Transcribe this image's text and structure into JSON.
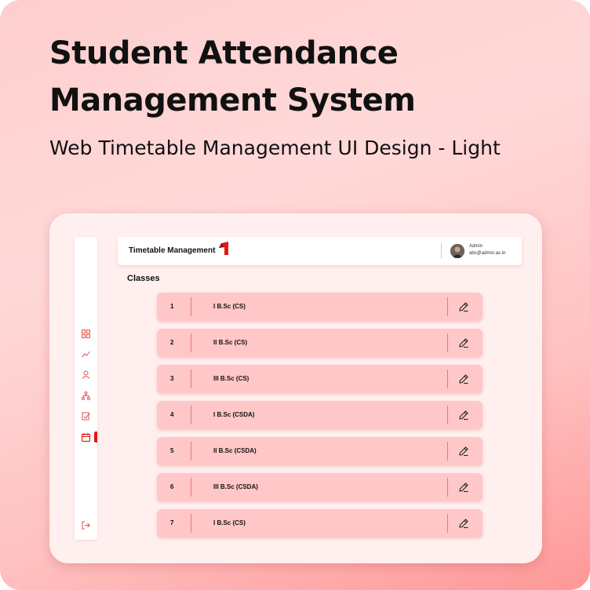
{
  "poster": {
    "title_line1": "Student Attendance",
    "title_line2": "Management System",
    "subtitle": "Web Timetable Management UI Design - Light"
  },
  "header": {
    "title": "Timetable Management",
    "user_role": "Admin",
    "user_email": "abc@admin.ac.in"
  },
  "sidebar": {
    "items": [
      {
        "icon": "dashboard-icon"
      },
      {
        "icon": "analytics-icon"
      },
      {
        "icon": "user-icon"
      },
      {
        "icon": "hierarchy-icon"
      },
      {
        "icon": "report-icon"
      },
      {
        "icon": "calendar-icon",
        "active": true
      }
    ],
    "footer_icon": "logout-icon"
  },
  "classes": {
    "title": "Classes",
    "rows": [
      {
        "num": "1",
        "name": "I B.Sc (CS)"
      },
      {
        "num": "2",
        "name": "II B.Sc (CS)"
      },
      {
        "num": "3",
        "name": "III B.Sc (CS)"
      },
      {
        "num": "4",
        "name": "I B.Sc (CSDA)"
      },
      {
        "num": "5",
        "name": "II B.Sc (CSDA)"
      },
      {
        "num": "6",
        "name": "III B.Sc (CSDA)"
      },
      {
        "num": "7",
        "name": "I B.Sc (CS)"
      }
    ]
  },
  "colors": {
    "accent": "#e01818",
    "row_bg": "#ffc7c7",
    "panel_bg": "#fff0ef"
  }
}
